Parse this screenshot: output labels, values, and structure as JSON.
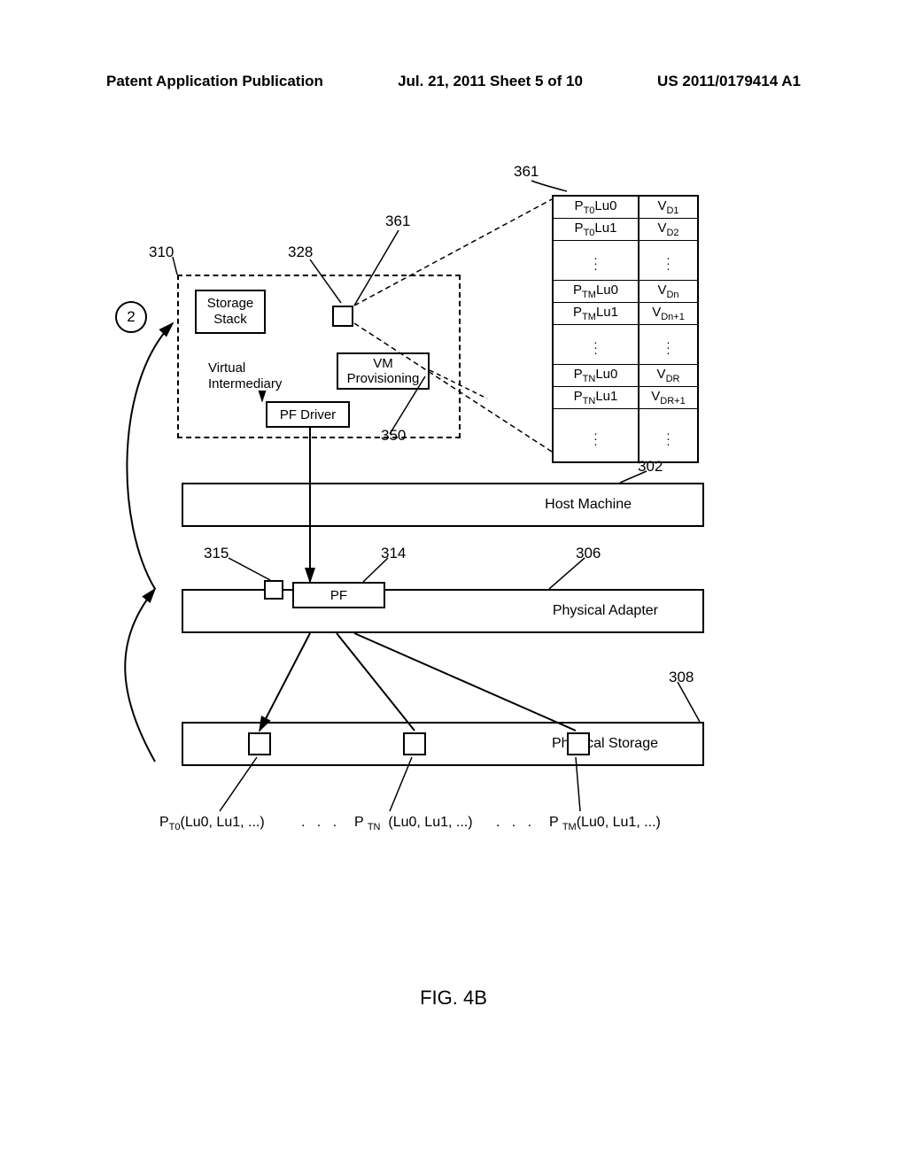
{
  "header": {
    "left": "Patent Application Publication",
    "center": "Jul. 21, 2011  Sheet 5 of 10",
    "right": "US 2011/0179414 A1"
  },
  "labels": {
    "l361a": "361",
    "l361b": "361",
    "l310": "310",
    "l328": "328",
    "l350": "350",
    "l302": "302",
    "l314": "314",
    "l315": "315",
    "l306": "306",
    "l308": "308",
    "circle2": "2"
  },
  "boxes": {
    "storage_stack": "Storage\nStack",
    "virtual_intermediary": "Virtual\nIntermediary",
    "vm_provisioning": "VM\nProvisioning",
    "pf_driver": "PF Driver",
    "host_machine": "Host Machine",
    "pf": "PF",
    "physical_adapter": "Physical Adapter",
    "physical_storage": "Physical Storage"
  },
  "table": {
    "rows": [
      {
        "left": "P_T0 Lu0",
        "right": "V_D1"
      },
      {
        "left": "P_T0 Lu1",
        "right": "V_D2"
      },
      {
        "left": "dots",
        "right": "dots"
      },
      {
        "left": "P_TM Lu0",
        "right": "V_Dn"
      },
      {
        "left": "P_TM Lu1",
        "right": "V_Dn+1"
      },
      {
        "left": "dots",
        "right": "dots"
      },
      {
        "left": "P_TN Lu0",
        "right": "V_DR"
      },
      {
        "left": "P_TN Lu1",
        "right": "V_DR+1"
      },
      {
        "left": "dots",
        "right": "dots"
      }
    ]
  },
  "bottom_labels": {
    "pt0": "P_T0(Lu0, Lu1, ...)",
    "ptn": "P_TN  (Lu0, Lu1, ...)",
    "ptm": "P_TM(Lu0, Lu1, ...)",
    "dots": ".    .    ."
  },
  "figure": "FIG. 4B"
}
